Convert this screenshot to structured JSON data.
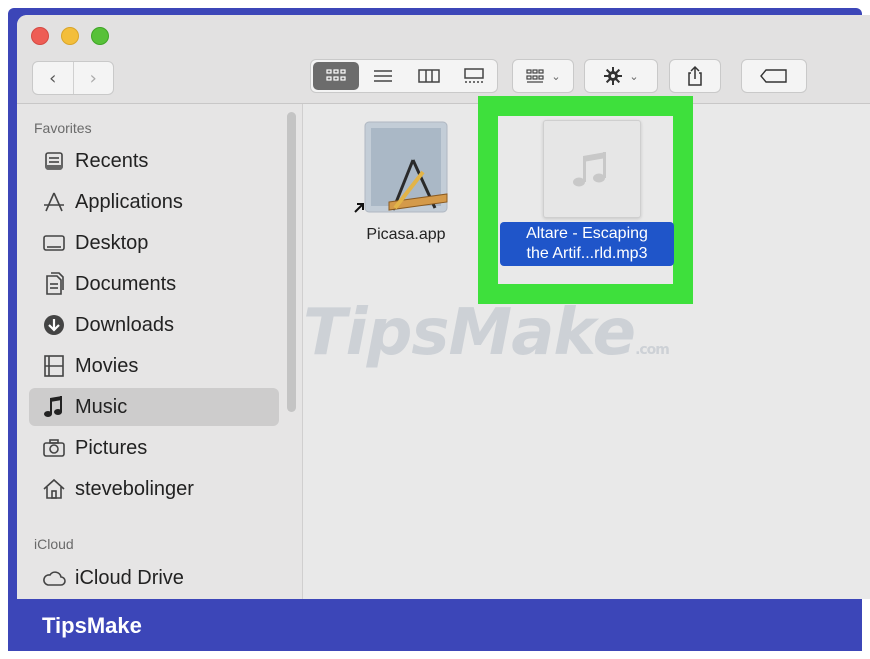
{
  "window": {
    "nav": {
      "back": "‹",
      "forward": "›"
    }
  },
  "sidebar": {
    "favorites_title": "Favorites",
    "items": [
      {
        "label": "Recents",
        "icon": "recents-icon"
      },
      {
        "label": "Applications",
        "icon": "applications-icon"
      },
      {
        "label": "Desktop",
        "icon": "desktop-icon"
      },
      {
        "label": "Documents",
        "icon": "documents-icon"
      },
      {
        "label": "Downloads",
        "icon": "downloads-icon"
      },
      {
        "label": "Movies",
        "icon": "movies-icon"
      },
      {
        "label": "Music",
        "icon": "music-icon",
        "selected": true
      },
      {
        "label": "Pictures",
        "icon": "pictures-icon"
      },
      {
        "label": "stevebolinger",
        "icon": "home-icon"
      }
    ],
    "icloud_title": "iCloud",
    "icloud_items": [
      {
        "label": "iCloud Drive",
        "icon": "icloud-icon"
      }
    ]
  },
  "files": [
    {
      "label_line1": "Picasa.app",
      "label_line2": "",
      "icon": "picasa-app-icon"
    },
    {
      "label_line1": "Altare - Escaping",
      "label_line2": "the Artif...rld.mp3",
      "icon": "mp3-file-icon",
      "selected": true
    }
  ],
  "watermark": {
    "text": "TipsMake",
    "suffix": ".com"
  },
  "footer": {
    "brand": "TipsMake"
  },
  "colors": {
    "highlight": "#3ee03c",
    "selection": "#1f55c9",
    "frame": "#3c46b8"
  }
}
